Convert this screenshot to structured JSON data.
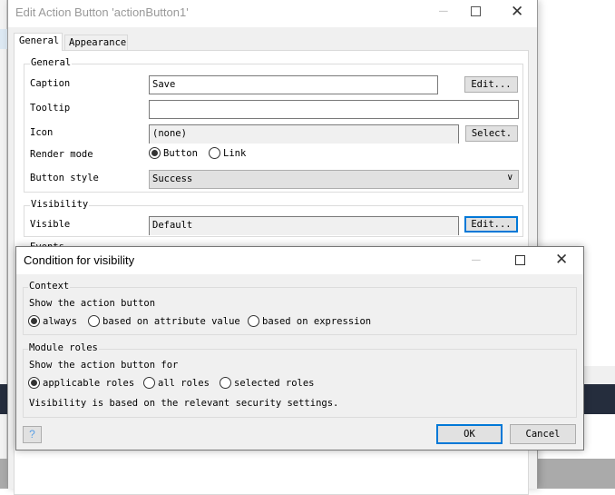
{
  "main_dialog": {
    "title": "Edit Action Button 'actionButton1'",
    "tabs": [
      {
        "label": "General",
        "active": true
      },
      {
        "label": "Appearance",
        "active": false
      }
    ],
    "general_group": {
      "title": "General",
      "caption_label": "Caption",
      "caption_value": "Save",
      "caption_edit": "Edit...",
      "tooltip_label": "Tooltip",
      "tooltip_value": "",
      "icon_label": "Icon",
      "icon_value": "(none)",
      "icon_select": "Select.",
      "render_mode_label": "Render mode",
      "render_options": [
        "Button",
        "Link"
      ],
      "render_selected": "Button",
      "button_style_label": "Button style",
      "button_style_value": "Success"
    },
    "visibility_group": {
      "title": "Visibility",
      "visible_label": "Visible",
      "visible_value": "Default",
      "visible_edit": "Edit..."
    },
    "partial_group_title": "Events"
  },
  "condition_dialog": {
    "title": "Condition for visibility",
    "context": {
      "title": "Context",
      "prompt": "Show the action button",
      "options": [
        "always",
        "based on attribute value",
        "based on expression"
      ],
      "selected": "always"
    },
    "module_roles": {
      "title": "Module roles",
      "prompt": "Show the action button for",
      "options": [
        "applicable roles",
        "all roles",
        "selected roles"
      ],
      "selected": "applicable roles",
      "note": "Visibility is based on the relevant security settings."
    },
    "ok_label": "OK",
    "cancel_label": "Cancel",
    "help_icon": "question-icon"
  },
  "colors": {
    "focus": "#0078d7",
    "dialog_bg": "#f0f0f0",
    "background_band": "#252d3d"
  }
}
